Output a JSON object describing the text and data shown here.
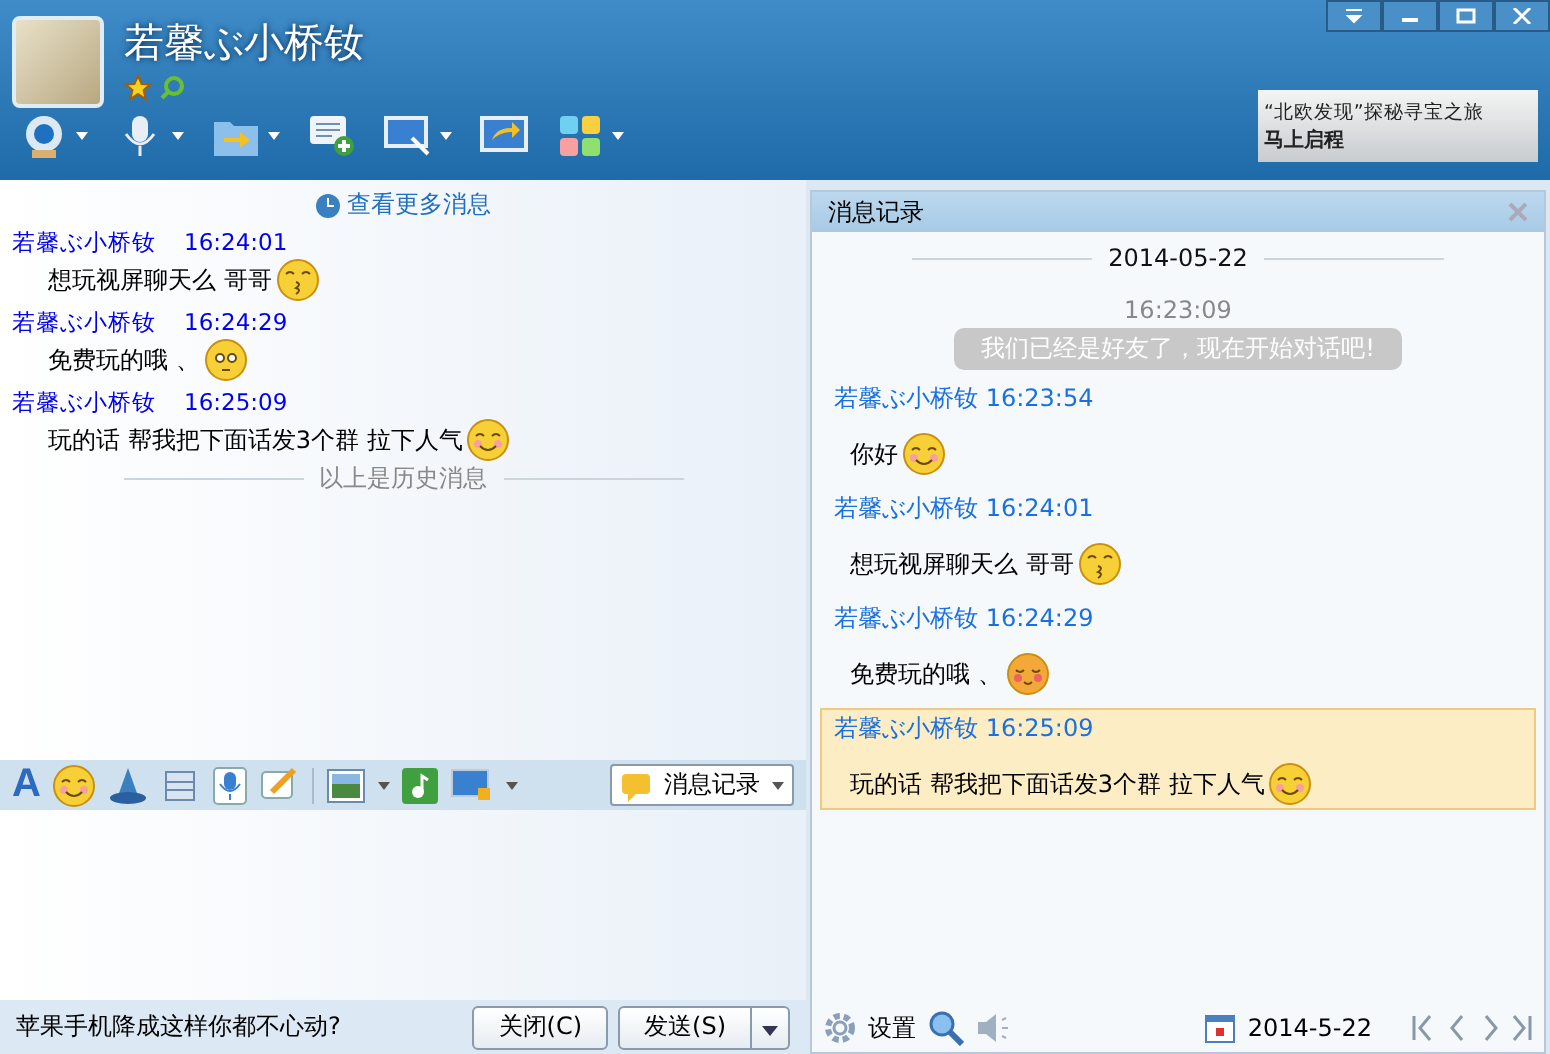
{
  "header": {
    "name": "若馨ぶ小桥钕",
    "ad": {
      "title": "“北欧发现”探秘寻宝之旅",
      "subtitle": "马上启程"
    }
  },
  "toolbar": [
    {
      "kind": "camera",
      "dropdown": true
    },
    {
      "kind": "mic",
      "dropdown": true
    },
    {
      "kind": "folder",
      "dropdown": true
    },
    {
      "kind": "chat-add",
      "dropdown": false
    },
    {
      "kind": "screen",
      "dropdown": true
    },
    {
      "kind": "share",
      "dropdown": false
    },
    {
      "kind": "apps",
      "dropdown": true
    }
  ],
  "chat": {
    "more_link": "查看更多消息",
    "history_divider": "以上是历史消息",
    "messages": [
      {
        "sender": "若馨ぶ小桥钕",
        "time": "16:24:01",
        "text": "想玩视屏聊天么  哥哥",
        "emoticon": {
          "kind": "kiss"
        }
      },
      {
        "sender": "若馨ぶ小桥钕",
        "time": "16:24:29",
        "text": "免费玩的哦 、",
        "emoticon": {
          "kind": "dazed"
        }
      },
      {
        "sender": "若馨ぶ小桥钕",
        "time": "16:25:09",
        "text": "玩的话  帮我把下面话发3个群  拉下人气",
        "emoticon": {
          "kind": "smile"
        }
      }
    ]
  },
  "input_toolbar": {
    "font_button": "A",
    "history_button": "消息记录"
  },
  "footer": {
    "ad_text": "苹果手机降成这样你都不心动?",
    "close_button": "关闭(C)",
    "send_button": "发送(S)"
  },
  "history": {
    "title": "消息记录",
    "date": "2014-05-22",
    "system_time": "16:23:09",
    "system_text": "我们已经是好友了，现在开始对话吧!",
    "messages": [
      {
        "sender": "若馨ぶ小桥钕",
        "time": "16:23:54",
        "text": "你好",
        "emoticon": {
          "kind": "smile"
        },
        "selected": false
      },
      {
        "sender": "若馨ぶ小桥钕",
        "time": "16:24:01",
        "text": "想玩视屏聊天么  哥哥",
        "emoticon": {
          "kind": "kiss"
        },
        "selected": false
      },
      {
        "sender": "若馨ぶ小桥钕",
        "time": "16:24:29",
        "text": "免费玩的哦 、",
        "emoticon": {
          "kind": "shy"
        },
        "selected": false
      },
      {
        "sender": "若馨ぶ小桥钕",
        "time": "16:25:09",
        "text": "玩的话  帮我把下面话发3个群  拉下人气",
        "emoticon": {
          "kind": "smile"
        },
        "selected": true
      }
    ],
    "settings_label": "设置",
    "footer_date": "2014-5-22"
  }
}
